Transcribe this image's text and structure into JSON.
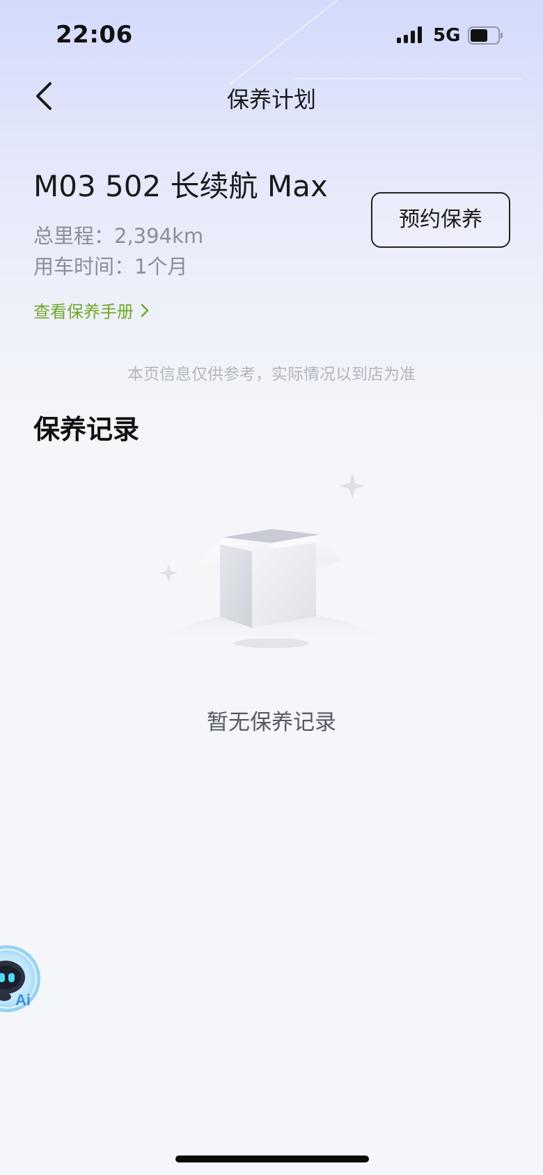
{
  "status_bar": {
    "time": "22:06",
    "network": "5G",
    "icons": [
      "signal-icon",
      "battery-icon"
    ]
  },
  "header": {
    "title": "保养计划",
    "back_icon": "chevron-left-icon"
  },
  "vehicle": {
    "name": "M03 502 长续航 Max",
    "mileage_label": "总里程：",
    "mileage_value": "2,394km",
    "usage_label": "用车时间：",
    "usage_value": "1个月",
    "book_button": "预约保养",
    "manual_link": "查看保养手册",
    "manual_link_icon": "chevron-right-icon"
  },
  "disclaimer": "本页信息仅供参考，实际情况以到店为准",
  "records": {
    "title": "保养记录",
    "empty_icon": "empty-box-icon",
    "empty_text": "暂无保养记录"
  },
  "ai_assistant": {
    "label": "Ai",
    "icon": "robot-icon"
  },
  "colors": {
    "accent_link": "#6fa82a",
    "primary_text": "#1a1a1a",
    "secondary_text": "#8a8f99",
    "hint_text": "#b2b6bf",
    "background_top": "#d3dafb",
    "background": "#f5f6fa"
  }
}
